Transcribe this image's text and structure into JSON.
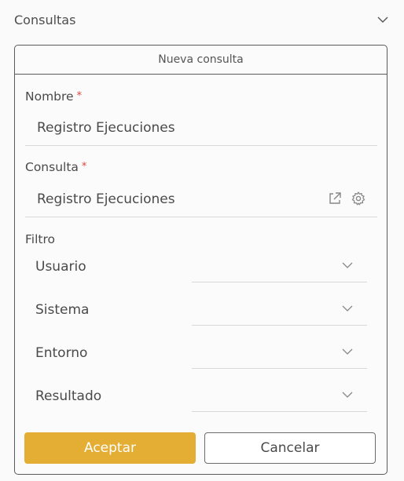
{
  "section": {
    "title": "Consultas",
    "chevron_icon": "chevron-down-icon"
  },
  "panel": {
    "title": "Nueva consulta"
  },
  "fields": {
    "nombre": {
      "label": "Nombre",
      "required_mark": "*",
      "value": "Registro Ejecuciones"
    },
    "consulta": {
      "label": "Consulta",
      "required_mark": "*",
      "value": "Registro Ejecuciones",
      "icons": [
        "external-link-icon",
        "gear-icon"
      ]
    }
  },
  "filtro": {
    "label": "Filtro",
    "selects": [
      {
        "label": "Usuario",
        "value": ""
      },
      {
        "label": "Sistema",
        "value": ""
      },
      {
        "label": "Entorno",
        "value": ""
      },
      {
        "label": "Resultado",
        "value": ""
      }
    ]
  },
  "actions": {
    "accept_label": "Aceptar",
    "cancel_label": "Cancelar"
  },
  "colors": {
    "accent": "#e4ad33",
    "required": "#d9473f",
    "text": "#4a4a4a",
    "border": "#5a5a5a",
    "underline": "#d9d9d9"
  }
}
